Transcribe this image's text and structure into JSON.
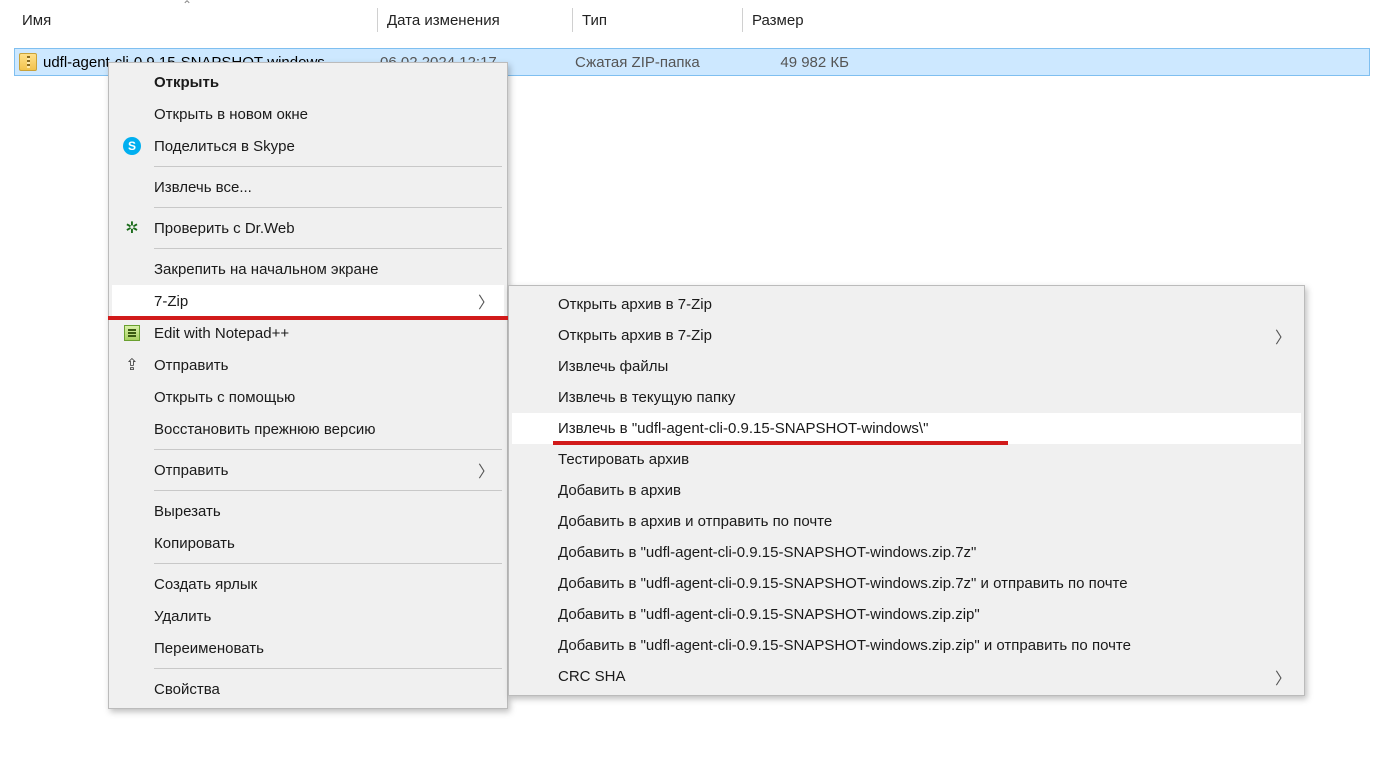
{
  "columns": {
    "name": "Имя",
    "date": "Дата изменения",
    "type": "Тип",
    "size": "Размер"
  },
  "file": {
    "name": "udfl-agent-cli-0.9.15-SNAPSHOT-windows",
    "date": "06.02.2024 12:17",
    "type": "Сжатая ZIP-папка",
    "size": "49 982 КБ"
  },
  "ctx": {
    "open": "Открыть",
    "open_new_window": "Открыть в новом окне",
    "share_skype": "Поделиться в Skype",
    "extract_all": "Извлечь все...",
    "drweb": "Проверить с Dr.Web",
    "pin_start": "Закрепить на начальном экране",
    "seven_zip": "7-Zip",
    "edit_npp": "Edit with Notepad++",
    "send": "Отправить",
    "open_with": "Открыть с помощью",
    "restore_prev": "Восстановить прежнюю версию",
    "send2": "Отправить",
    "cut": "Вырезать",
    "copy": "Копировать",
    "shortcut": "Создать ярлык",
    "delete": "Удалить",
    "rename": "Переименовать",
    "properties": "Свойства"
  },
  "sub": {
    "open_archive": "Открыть архив в 7-Zip",
    "open_archive2": "Открыть архив в 7-Zip",
    "extract_files": "Извлечь файлы",
    "extract_here": "Извлечь в текущую папку",
    "extract_to": "Извлечь в \"udfl-agent-cli-0.9.15-SNAPSHOT-windows\\\"",
    "test": "Тестировать архив",
    "add": "Добавить в архив",
    "add_email": "Добавить в архив и отправить по почте",
    "add_7z": "Добавить в \"udfl-agent-cli-0.9.15-SNAPSHOT-windows.zip.7z\"",
    "add_7z_email": "Добавить в \"udfl-agent-cli-0.9.15-SNAPSHOT-windows.zip.7z\" и отправить по почте",
    "add_zip": "Добавить в \"udfl-agent-cli-0.9.15-SNAPSHOT-windows.zip.zip\"",
    "add_zip_email": "Добавить в \"udfl-agent-cli-0.9.15-SNAPSHOT-windows.zip.zip\" и отправить по почте",
    "crc": "CRC SHA"
  }
}
